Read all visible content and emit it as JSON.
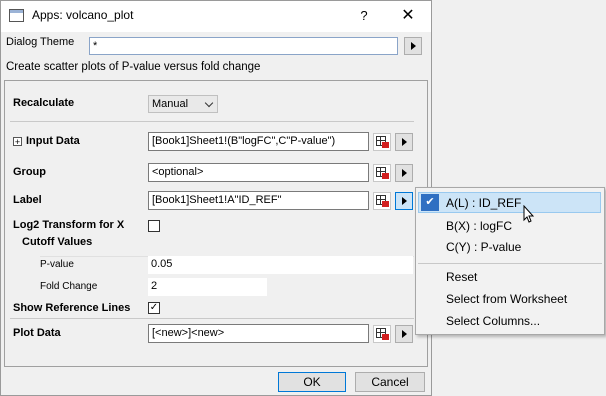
{
  "window": {
    "title": "Apps: volcano_plot",
    "help": "?",
    "close": "✕"
  },
  "theme": {
    "label": "Dialog Theme",
    "value": "*"
  },
  "description": "Create scatter plots of P-value versus fold change",
  "fields": {
    "recalculate": {
      "label": "Recalculate",
      "value": "Manual"
    },
    "input_data": {
      "label": "Input Data",
      "value": "[Book1]Sheet1!(B\"logFC\",C\"P-value\")"
    },
    "group": {
      "label": "Group",
      "value": "<optional>"
    },
    "label": {
      "label": "Label",
      "value": "[Book1]Sheet1!A\"ID_REF\""
    },
    "log2": {
      "label": "Log2 Transform for X",
      "checked": false
    },
    "cutoff": {
      "label": "Cutoff Values",
      "pvalue": {
        "label": "P-value",
        "value": "0.05"
      },
      "foldchange": {
        "label": "Fold Change",
        "value": "2"
      }
    },
    "show_ref": {
      "label": "Show Reference Lines",
      "checked": true,
      "mark": "✓"
    },
    "plot_data": {
      "label": "Plot Data",
      "value": "[<new>]<new>"
    }
  },
  "buttons": {
    "ok": "OK",
    "cancel": "Cancel"
  },
  "menu": {
    "checked_item": "A(L) : ID_REF",
    "check_mark": "✔",
    "items": [
      "B(X) : logFC",
      "C(Y) : P-value"
    ],
    "actions": [
      "Reset",
      "Select from Worksheet",
      "Select Columns..."
    ]
  },
  "icons": [
    "app-window-icon",
    "help-icon",
    "close-icon",
    "arrow-right-icon",
    "select-from-table-icon",
    "expand-plus-icon",
    "checkmark-icon",
    "mouse-cursor-icon",
    "dropdown-chevron-icon"
  ],
  "colors": {
    "highlight": "#cce4f7",
    "check_accent": "#2f6fc2",
    "ok_border": "#0078d7"
  }
}
